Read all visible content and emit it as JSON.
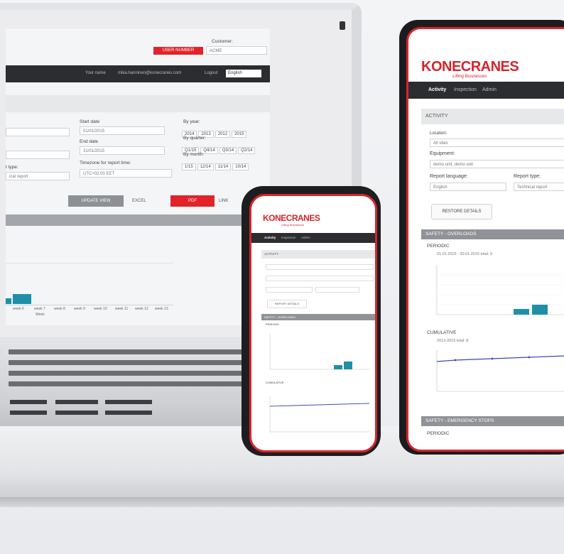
{
  "laptop": {
    "customer_label": "Customer:",
    "customer_value": "ACME",
    "red_button": "USER NUMBER",
    "topbar_name": "Your name",
    "topbar_email": "mika.hanninen@konecranes.com",
    "topbar_logout": "Logout",
    "topbar_language": "English",
    "start_date_label": "Start date",
    "start_date_value": "01/01/2015",
    "end_date_label": "End date",
    "end_date_value": "31/01/2015",
    "by_year_label": "By year:",
    "years": [
      "2014",
      "2013",
      "2012",
      "2015"
    ],
    "by_quarter_label": "By quarter:",
    "quarters": [
      "Q1/15",
      "Q4/14",
      "Q3/14",
      "Q2/14"
    ],
    "by_month_label": "By month:",
    "months": [
      "1/15",
      "12/14",
      "11/14",
      "10/14"
    ],
    "timezone_label": "Timezone for report time:",
    "timezone_value": "UTC+02:00 EET",
    "report_type_label": "t type:",
    "report_type_value": "ical report",
    "update_button": "UPDATE VIEW",
    "excel_button": "EXCEL",
    "pdf_button": "PDF",
    "link_button": "LINK",
    "x_ticks": [
      "week 6",
      "week 7",
      "week 8",
      "week 9",
      "week 10",
      "week 11",
      "week 12",
      "week 13"
    ],
    "x_title": "Week"
  },
  "tablet": {
    "logo": "KONECRANES",
    "logo_sub": "Lifting Businesses",
    "nav": [
      "Activity",
      "Inspection",
      "Admin"
    ],
    "activity_header": "ACTIVITY",
    "location_label": "Location:",
    "location_value": "All sites",
    "equipment_label": "Equipment:",
    "equipment_value": "demo unit, demo unit",
    "report_language_label": "Report language:",
    "report_language_value": "English",
    "report_type_label": "Report type:",
    "report_type_value": "Technical report",
    "details_button": "RESTORE DETAILS",
    "overloads_header": "SAFETY - OVERLOADS",
    "periodic_label": "PERIODIC",
    "periodic_range": "01.01.2015 - 30.01.2015 total: 9",
    "cumulative_label": "CUMULATIVE",
    "cumulative_range": "2013-2015 total: 8",
    "emergency_header": "SAFETY - EMERGENCY STOPS",
    "periodic_label_2": "PERIODIC"
  },
  "phone": {
    "logo": "KONECRANES",
    "logo_sub": "Lifting Businesses",
    "nav": [
      "Activity",
      "Inspection",
      "Admin"
    ],
    "activity_header": "ACTIVITY",
    "details_button": "REPORT DETAILS",
    "overloads_header": "SAFETY - OVERLOADS",
    "periodic_label": "PERIODIC",
    "cumulative_label": "CUMULATIVE"
  },
  "colors": {
    "brand_red": "#d6252c",
    "bar_teal": "#1f8fa8",
    "dark_nav": "#2b2d31"
  }
}
